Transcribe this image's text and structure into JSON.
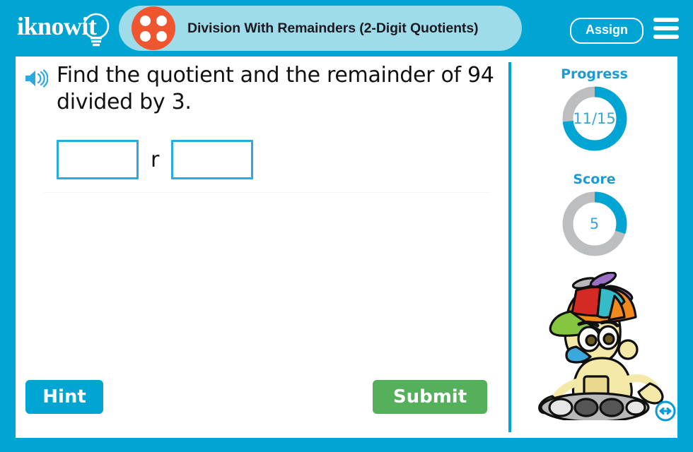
{
  "header": {
    "logo_text": "iknowit",
    "logo_icon": "lightbulb-icon",
    "dice_icon": "dice-four-icon",
    "title": "Division With Remainders (2-Digit Quotients)",
    "assign_label": "Assign",
    "menu_icon": "hamburger-menu-icon"
  },
  "question": {
    "speaker_icon": "speaker-audio-icon",
    "text": "Find the quotient and the remainder of 94 divided by 3.",
    "quotient_value": "",
    "quotient_placeholder": "",
    "separator_label": "r",
    "remainder_value": "",
    "remainder_placeholder": ""
  },
  "actions": {
    "hint_label": "Hint",
    "submit_label": "Submit"
  },
  "sidebar": {
    "progress": {
      "label": "Progress",
      "value_text": "11/15",
      "current": 11,
      "total": 15,
      "percent": 73.3
    },
    "score": {
      "label": "Score",
      "value_text": "5",
      "value": 5,
      "percent": 30
    },
    "mascot_icon": "robot-mascot-icon",
    "nav_arrow_icon": "left-right-arrow-icon"
  },
  "colors": {
    "brand_blue": "#00a5d4",
    "banner_blue": "#9fdcea",
    "accent_orange": "#ef5630",
    "submit_green": "#54b05a",
    "ring_track_gray": "#bcbec0",
    "input_border": "#29aae1"
  }
}
